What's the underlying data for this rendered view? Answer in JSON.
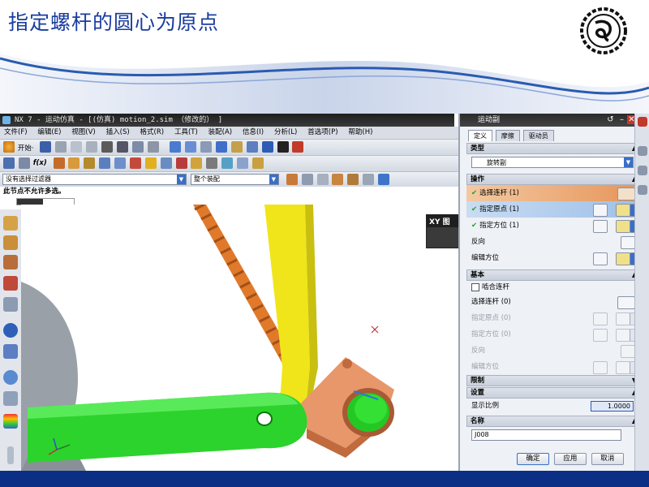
{
  "slide": {
    "title": "指定螺杆的圆心为原点",
    "logo_icon": "round-seal-logo-icon",
    "colors": {
      "title": "#1a3c9e",
      "wave": "#2a5bb0",
      "bottom_bar": "#0c2f86"
    }
  },
  "window": {
    "app_label": "NX 7 - 运动仿真 - [(仿真) motion_2.sim （修改的） ]"
  },
  "menu": [
    "文件(F)",
    "编辑(E)",
    "视图(V)",
    "插入(S)",
    "格式(R)",
    "工具(T)",
    "装配(A)",
    "信息(I)",
    "分析(L)",
    "首选项(P)",
    "帮助(H)"
  ],
  "toolbar": {
    "start_label": "开始·",
    "fx_label": "f(x)",
    "filter_value": "没有选择过滤器",
    "scope_value": "整个装配"
  },
  "status": {
    "message": "此节点不允许多选。",
    "progress": 0.45
  },
  "viewport": {
    "popup_title": "XY 图"
  },
  "dialog": {
    "title": "运动副",
    "tabs": [
      "定义",
      "摩擦",
      "驱动员"
    ],
    "type_section": "类型",
    "type_value": "旋转副",
    "action_section": "操作",
    "action_rows": [
      {
        "label": "选择连杆 (1)"
      },
      {
        "label": "指定原点 (1)"
      },
      {
        "label": "指定方位 (1)"
      }
    ],
    "reverse_label": "反向",
    "edit_orient_label": "编辑方位",
    "base_section": "基本",
    "snap_link_label": "啮合连杆",
    "base_rows": [
      {
        "label": "选择连杆 (0)"
      },
      {
        "label": "指定原点 (0)"
      },
      {
        "label": "指定方位 (0)"
      },
      {
        "label": "反向"
      },
      {
        "label": "编辑方位"
      }
    ],
    "limits_section": "限制",
    "settings_section": "设置",
    "display_scale_label": "显示比例",
    "display_scale_value": "1.0000",
    "name_section": "名称",
    "name_value": "J008",
    "ok_label": "确定",
    "apply_label": "应用",
    "cancel_label": "取消"
  }
}
